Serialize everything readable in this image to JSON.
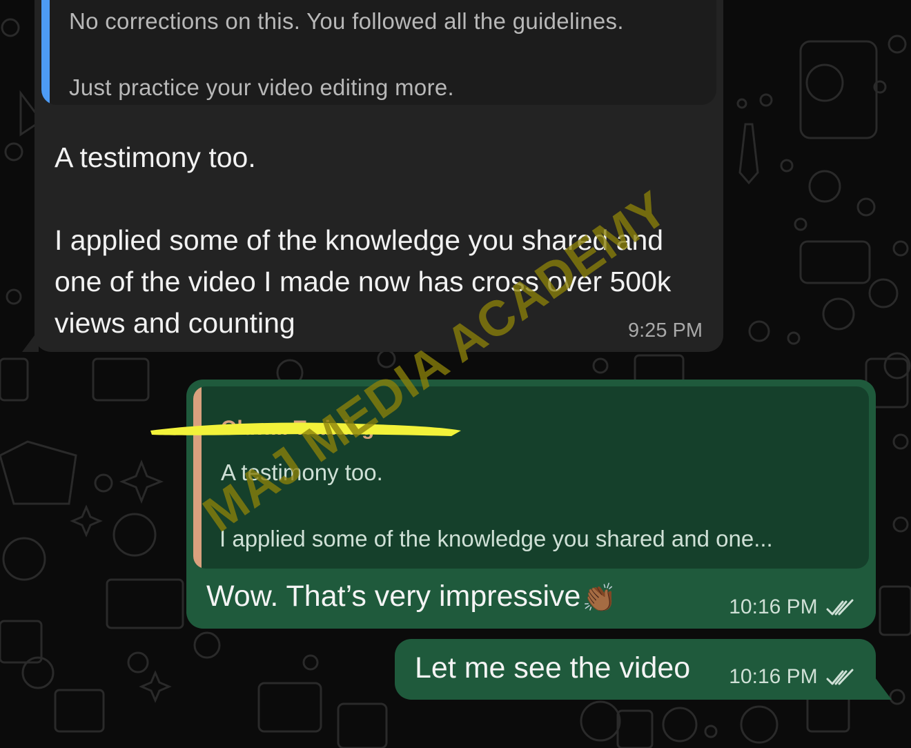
{
  "incoming": {
    "quote": {
      "line1": "No corrections on this. You followed all the guidelines.",
      "line2": "Just practice your video editing more."
    },
    "body_p1": "A testimony too.",
    "body_p2": "I applied some of the knowledge you shared and one of the video I made now has cross over 500k views and counting",
    "time": "9:25 PM"
  },
  "reply": {
    "quote": {
      "sender_redacted": "Oluw... Training",
      "line1": "A testimony too.",
      "line2": "I applied some of the knowledge you shared and one..."
    },
    "message": "Wow. That’s very impressive",
    "emoji": "👏🏾",
    "time": "10:16 PM",
    "status": "read"
  },
  "outgoing": {
    "message": "Let me see the video",
    "time": "10:16 PM",
    "status": "read"
  },
  "overlay": {
    "watermark": "MAJ MEDIA ACADEMY",
    "highlight_color": "#f2f23a"
  },
  "colors": {
    "background": "#0b0b0b",
    "incoming_bubble": "#232323",
    "outgoing_bubble": "#1f5a3c",
    "quote_bar_incoming": "#4d9bf5",
    "quote_bar_outgoing": "#d9a17e"
  }
}
